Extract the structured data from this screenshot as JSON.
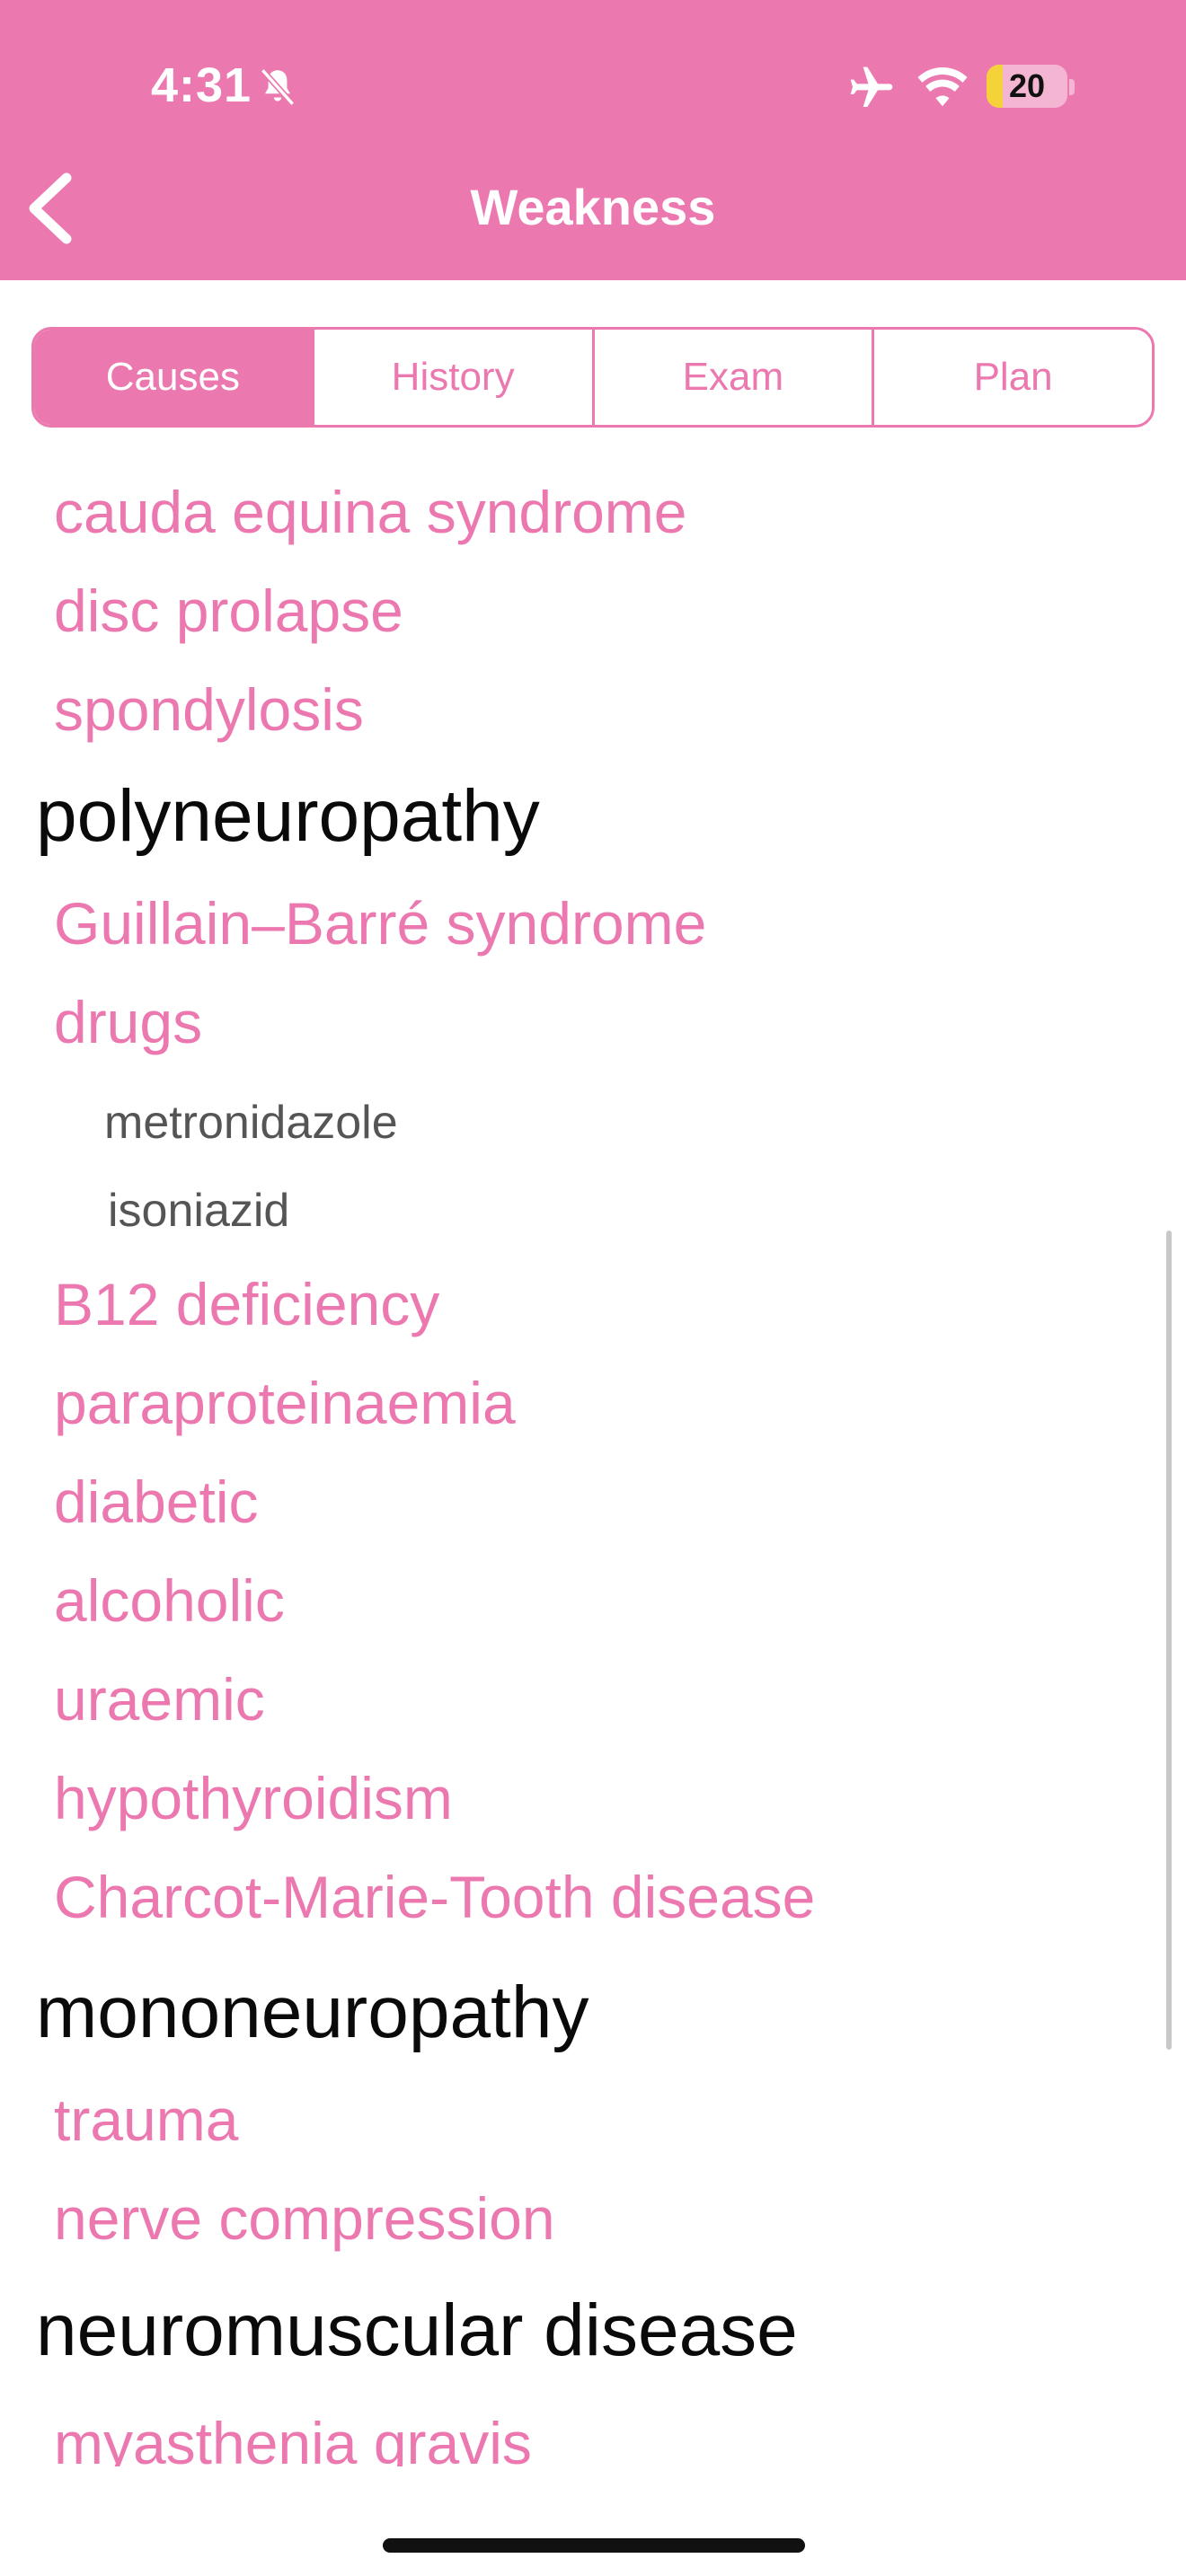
{
  "status": {
    "time": "4:31",
    "battery": "20",
    "battery_level": 0.2
  },
  "nav": {
    "title": "Weakness"
  },
  "tabs": [
    {
      "label": "Causes",
      "active": true
    },
    {
      "label": "History",
      "active": false
    },
    {
      "label": "Exam",
      "active": false
    },
    {
      "label": "Plan",
      "active": false
    }
  ],
  "list": [
    {
      "type": "link",
      "text": "cauda equina syndrome"
    },
    {
      "type": "link",
      "text": "disc prolapse"
    },
    {
      "type": "link",
      "text": "spondylosis"
    },
    {
      "type": "heading",
      "text": "polyneuropathy"
    },
    {
      "type": "link",
      "text": "Guillain–Barré syndrome"
    },
    {
      "type": "link",
      "text": "drugs"
    },
    {
      "type": "sub",
      "text": "metronidazole"
    },
    {
      "type": "sub",
      "text": "isoniazid"
    },
    {
      "type": "link",
      "text": "B12 deficiency"
    },
    {
      "type": "link",
      "text": "paraproteinaemia"
    },
    {
      "type": "link",
      "text": "diabetic"
    },
    {
      "type": "link",
      "text": "alcoholic"
    },
    {
      "type": "link",
      "text": "uraemic"
    },
    {
      "type": "link",
      "text": "hypothyroidism"
    },
    {
      "type": "link",
      "text": "Charcot-Marie-Tooth disease"
    },
    {
      "type": "heading",
      "text": "mononeuropathy"
    },
    {
      "type": "link",
      "text": "trauma"
    },
    {
      "type": "link",
      "text": "nerve compression"
    },
    {
      "type": "heading",
      "text": "neuromuscular disease"
    },
    {
      "type": "link",
      "text": "myasthenia gravis"
    }
  ]
}
